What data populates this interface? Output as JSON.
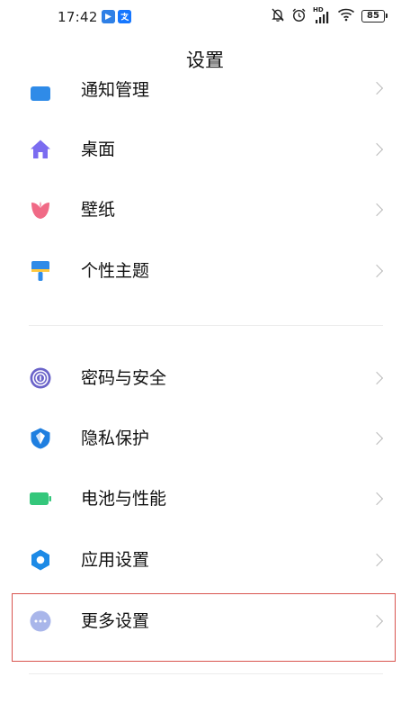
{
  "status_bar": {
    "time": "17:42",
    "network_label": "HD",
    "battery_level": "85"
  },
  "header": {
    "title": "设置"
  },
  "settings_list": [
    {
      "label": "通知管理",
      "icon": "notification-icon"
    },
    {
      "label": "桌面",
      "icon": "home-icon"
    },
    {
      "label": "壁纸",
      "icon": "wallpaper-icon"
    },
    {
      "label": "个性主题",
      "icon": "theme-brush-icon"
    },
    {
      "label": "密码与安全",
      "icon": "fingerprint-icon"
    },
    {
      "label": "隐私保护",
      "icon": "privacy-shield-icon"
    },
    {
      "label": "电池与性能",
      "icon": "battery-icon"
    },
    {
      "label": "应用设置",
      "icon": "gear-icon"
    },
    {
      "label": "更多设置",
      "icon": "more-icon"
    }
  ],
  "highlighted_item": "更多设置",
  "colors": {
    "home": "#7b6cf0",
    "wallpaper": "#f06a86",
    "theme": "#2f8be8",
    "fingerprint": "#6a63c9",
    "privacy": "#1f7fe0",
    "battery": "#34c77b",
    "gear": "#1d8ae6",
    "more": "#a9b6ea",
    "highlight": "#d9544f"
  }
}
